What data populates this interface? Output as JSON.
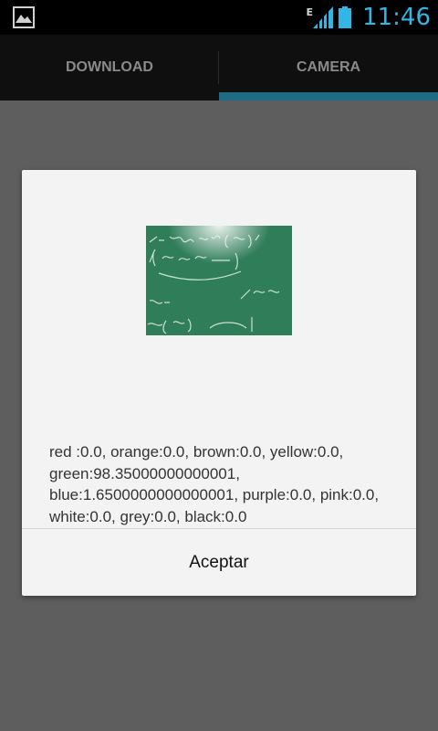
{
  "status_bar": {
    "gallery_icon": "image-icon",
    "network_label": "E",
    "signal_icon": "signal-icon",
    "battery_icon": "battery-icon",
    "time": "11:46",
    "time_color": "#33b5e5"
  },
  "tabs": [
    {
      "label": "DOWNLOAD",
      "selected": false
    },
    {
      "label": "CAMERA",
      "selected": true
    }
  ],
  "tab_indicator_color": "#1f6b87",
  "dialog": {
    "image_icon": "captured-photo",
    "message": "red :0.0, orange:0.0, brown:0.0, yellow:0.0, green:98.35000000000001, blue:1.6500000000000001, purple:0.0, pink:0.0, white:0.0, grey:0.0, black:0.0",
    "ok_label": "Aceptar"
  }
}
